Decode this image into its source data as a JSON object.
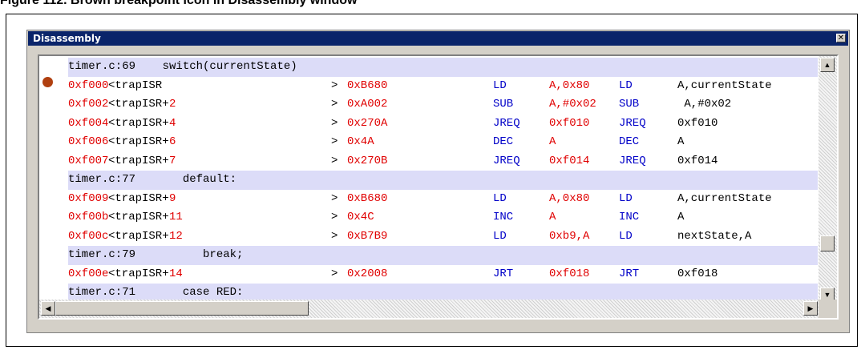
{
  "caption": "Figure 112. Brown breakpoint icon in Disassembly window",
  "window": {
    "title": "Disassembly",
    "close_glyph": "✕"
  },
  "colors": {
    "address": "#e00000",
    "instruction": "#0000c8",
    "source_bg": "#dcdcf8",
    "breakpoint": "#b04010",
    "titlebar": "#0a246a"
  },
  "lines": [
    {
      "kind": "source",
      "text": "timer.c:69    switch(currentState)"
    },
    {
      "kind": "asm",
      "breakpoint": true,
      "addr": "0xf000",
      "label": "<trapISR",
      "offset": "",
      "arrow": ">",
      "opcode": "0xB680",
      "mnem": "LD",
      "op1": "A,0x80",
      "mnem2": "LD",
      "op2": "A,currentState"
    },
    {
      "kind": "asm",
      "breakpoint": false,
      "addr": "0xf002",
      "label": "<trapISR+",
      "offset": "2",
      "arrow": ">",
      "opcode": "0xA002",
      "mnem": "SUB",
      "op1": "A,#0x02",
      "mnem2": "SUB",
      "op2": " A,#0x02"
    },
    {
      "kind": "asm",
      "breakpoint": false,
      "addr": "0xf004",
      "label": "<trapISR+",
      "offset": "4",
      "arrow": ">",
      "opcode": "0x270A",
      "mnem": "JREQ",
      "op1": "0xf010",
      "mnem2": "JREQ",
      "op2": "0xf010"
    },
    {
      "kind": "asm",
      "breakpoint": false,
      "addr": "0xf006",
      "label": "<trapISR+",
      "offset": "6",
      "arrow": ">",
      "opcode": "0x4A",
      "mnem": "DEC",
      "op1": "A",
      "mnem2": "DEC",
      "op2": "A"
    },
    {
      "kind": "asm",
      "breakpoint": false,
      "addr": "0xf007",
      "label": "<trapISR+",
      "offset": "7",
      "arrow": ">",
      "opcode": "0x270B",
      "mnem": "JREQ",
      "op1": "0xf014",
      "mnem2": "JREQ",
      "op2": "0xf014"
    },
    {
      "kind": "source",
      "text": "timer.c:77       default:"
    },
    {
      "kind": "asm",
      "breakpoint": false,
      "addr": "0xf009",
      "label": "<trapISR+",
      "offset": "9",
      "arrow": ">",
      "opcode": "0xB680",
      "mnem": "LD",
      "op1": "A,0x80",
      "mnem2": "LD",
      "op2": "A,currentState"
    },
    {
      "kind": "asm",
      "breakpoint": false,
      "addr": "0xf00b",
      "label": "<trapISR+",
      "offset": "11",
      "arrow": ">",
      "opcode": "0x4C",
      "mnem": "INC",
      "op1": "A",
      "mnem2": "INC",
      "op2": "A"
    },
    {
      "kind": "asm",
      "breakpoint": false,
      "addr": "0xf00c",
      "label": "<trapISR+",
      "offset": "12",
      "arrow": ">",
      "opcode": "0xB7B9",
      "mnem": "LD",
      "op1": "0xb9,A",
      "mnem2": "LD",
      "op2": "nextState,A"
    },
    {
      "kind": "source",
      "text": "timer.c:79          break;"
    },
    {
      "kind": "asm",
      "breakpoint": false,
      "addr": "0xf00e",
      "label": "<trapISR+",
      "offset": "14",
      "arrow": ">",
      "opcode": "0x2008",
      "mnem": "JRT",
      "op1": "0xf018",
      "mnem2": "JRT",
      "op2": "0xf018"
    },
    {
      "kind": "source",
      "text": "timer.c:71       case RED:"
    }
  ],
  "scrollbars": {
    "vertical_position": 0.82,
    "up_glyph": "▲",
    "down_glyph": "▼",
    "left_glyph": "◀",
    "right_glyph": "▶"
  }
}
